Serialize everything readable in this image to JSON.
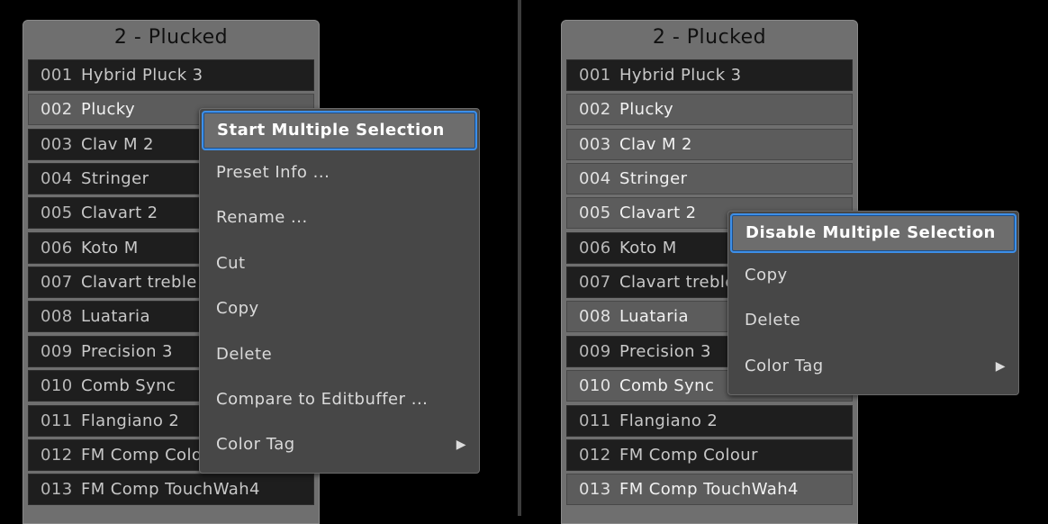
{
  "left": {
    "title": "2 - Plucked",
    "presets": [
      {
        "num": "001",
        "name": "Hybrid Pluck 3",
        "selected": false
      },
      {
        "num": "002",
        "name": "Plucky",
        "selected": true
      },
      {
        "num": "003",
        "name": "Clav M 2",
        "selected": false
      },
      {
        "num": "004",
        "name": "Stringer",
        "selected": false
      },
      {
        "num": "005",
        "name": "Clavart 2",
        "selected": false
      },
      {
        "num": "006",
        "name": "Koto M",
        "selected": false
      },
      {
        "num": "007",
        "name": "Clavart treble",
        "selected": false
      },
      {
        "num": "008",
        "name": "Luataria",
        "selected": false
      },
      {
        "num": "009",
        "name": "Precision 3",
        "selected": false
      },
      {
        "num": "010",
        "name": "Comb Sync",
        "selected": false
      },
      {
        "num": "011",
        "name": "Flangiano 2",
        "selected": false
      },
      {
        "num": "012",
        "name": "FM Comp Colour",
        "selected": false
      },
      {
        "num": "013",
        "name": "FM Comp TouchWah4",
        "selected": false
      }
    ],
    "menu": [
      {
        "label": "Start Multiple Selection",
        "highlighted": true
      },
      {
        "label": "Preset Info ..."
      },
      {
        "label": "Rename ..."
      },
      {
        "label": "Cut"
      },
      {
        "label": "Copy"
      },
      {
        "label": "Delete"
      },
      {
        "label": "Compare to Editbuffer ..."
      },
      {
        "label": "Color Tag",
        "submenu_arrow": "▶"
      }
    ]
  },
  "right": {
    "title": "2 - Plucked",
    "presets": [
      {
        "num": "001",
        "name": "Hybrid Pluck 3",
        "selected": false
      },
      {
        "num": "002",
        "name": "Plucky",
        "selected": true
      },
      {
        "num": "003",
        "name": "Clav M 2",
        "selected": true
      },
      {
        "num": "004",
        "name": "Stringer",
        "selected": true
      },
      {
        "num": "005",
        "name": "Clavart 2",
        "selected": true
      },
      {
        "num": "006",
        "name": "Koto M",
        "selected": false
      },
      {
        "num": "007",
        "name": "Clavart treble",
        "selected": false
      },
      {
        "num": "008",
        "name": "Luataria",
        "selected": true
      },
      {
        "num": "009",
        "name": "Precision 3",
        "selected": false
      },
      {
        "num": "010",
        "name": "Comb Sync",
        "selected": true
      },
      {
        "num": "011",
        "name": "Flangiano 2",
        "selected": false
      },
      {
        "num": "012",
        "name": "FM Comp Colour",
        "selected": false
      },
      {
        "num": "013",
        "name": "FM Comp TouchWah4",
        "selected": true
      }
    ],
    "menu": [
      {
        "label": "Disable Multiple Selection",
        "highlighted": true
      },
      {
        "label": "Copy"
      },
      {
        "label": "Delete"
      },
      {
        "label": "Color Tag",
        "submenu_arrow": "▶"
      }
    ]
  }
}
